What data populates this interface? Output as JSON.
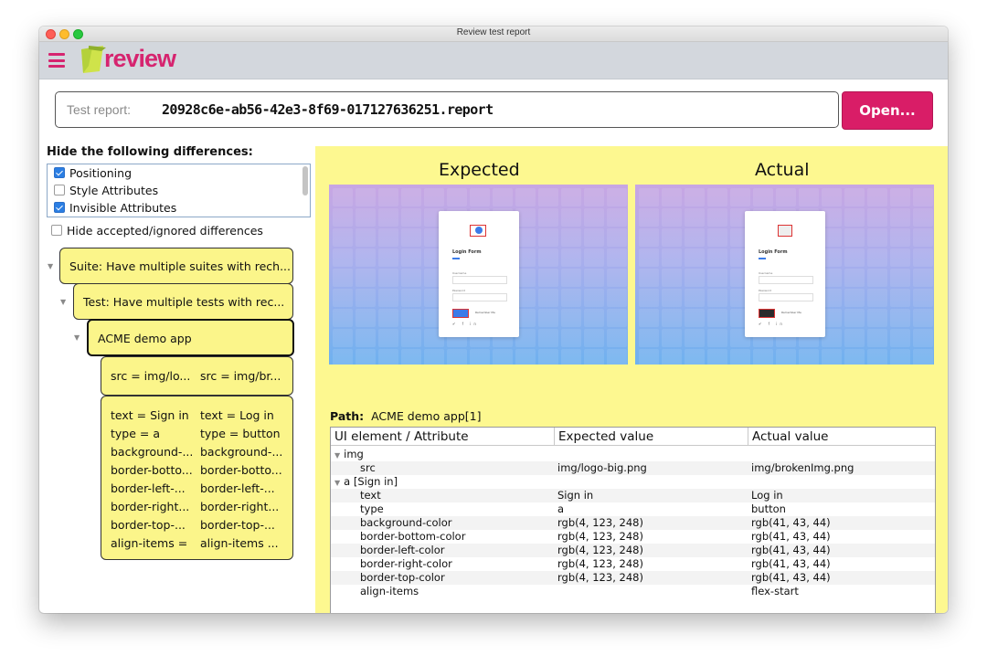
{
  "window": {
    "title": "Review test report"
  },
  "header": {
    "logo_text": "review",
    "menu_icon": "hamburger-icon"
  },
  "report": {
    "label": "Test report:",
    "value": "20928c6e-ab56-42e3-8f69-017127636251.report",
    "open_button": "Open..."
  },
  "filters": {
    "title": "Hide the following differences:",
    "items": [
      {
        "label": "Positioning",
        "checked": true
      },
      {
        "label": "Style Attributes",
        "checked": false
      },
      {
        "label": "Invisible Attributes",
        "checked": true
      }
    ],
    "hide_accepted": {
      "label": "Hide accepted/ignored differences",
      "checked": false
    }
  },
  "tree": {
    "suite": "Suite: Have multiple suites with rech...",
    "test": "Test: Have multiple tests with rec...",
    "app": "ACME demo app",
    "src_node": {
      "left": "src = img/lo...",
      "right": "src = img/br..."
    },
    "attr_node": {
      "left": [
        "text = Sign in",
        "type = a",
        "background-...",
        "border-botto...",
        "border-left-...",
        "border-right...",
        "border-top-...",
        "align-items ="
      ],
      "right": [
        "text = Log in",
        "type = button",
        "background-...",
        "border-botto...",
        "border-left-...",
        "border-right...",
        "border-top-...",
        "align-items ..."
      ]
    }
  },
  "compare": {
    "expected_title": "Expected",
    "actual_title": "Actual",
    "login_title": "Login Form",
    "login_username": "Username",
    "login_password": "Password",
    "login_remember": "Remember Me",
    "login_social": "𝕥 f in",
    "expected_button": "Sign in",
    "actual_button": "Log in"
  },
  "path": {
    "label": "Path:",
    "value": "ACME demo app[1]"
  },
  "table": {
    "headers": [
      "UI element / Attribute",
      "Expected value",
      "Actual value"
    ],
    "rows": [
      {
        "name": "img",
        "group": true,
        "expected": "",
        "actual": ""
      },
      {
        "name": "src",
        "group": false,
        "expected": "img/logo-big.png",
        "actual": "img/brokenImg.png"
      },
      {
        "name": "a [Sign in]",
        "group": true,
        "expected": "",
        "actual": ""
      },
      {
        "name": "text",
        "group": false,
        "expected": "Sign in",
        "actual": "Log in"
      },
      {
        "name": "type",
        "group": false,
        "expected": "a",
        "actual": "button"
      },
      {
        "name": "background-color",
        "group": false,
        "expected": "rgb(4, 123, 248)",
        "actual": "rgb(41, 43, 44)"
      },
      {
        "name": "border-bottom-color",
        "group": false,
        "expected": "rgb(4, 123, 248)",
        "actual": "rgb(41, 43, 44)"
      },
      {
        "name": "border-left-color",
        "group": false,
        "expected": "rgb(4, 123, 248)",
        "actual": "rgb(41, 43, 44)"
      },
      {
        "name": "border-right-color",
        "group": false,
        "expected": "rgb(4, 123, 248)",
        "actual": "rgb(41, 43, 44)"
      },
      {
        "name": "border-top-color",
        "group": false,
        "expected": "rgb(4, 123, 248)",
        "actual": "rgb(41, 43, 44)"
      },
      {
        "name": "align-items",
        "group": false,
        "expected": "",
        "actual": "flex-start"
      }
    ]
  },
  "colors": {
    "accent": "#d91d67",
    "panel": "#fdf890",
    "node": "#fbf58a"
  }
}
